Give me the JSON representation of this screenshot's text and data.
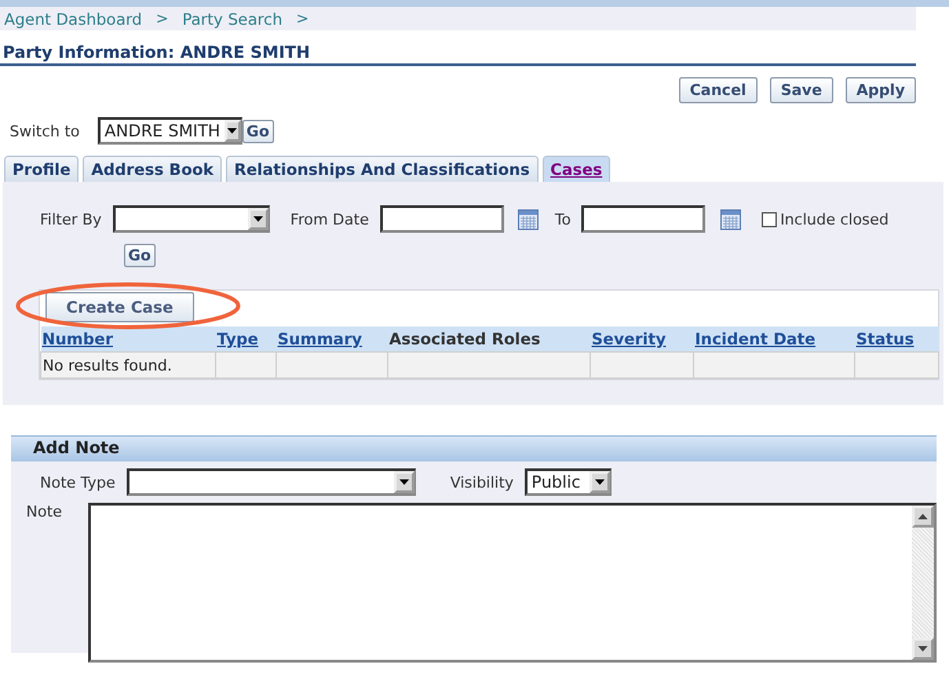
{
  "breadcrumbs": [
    {
      "label": "Agent Dashboard",
      "separator": ">"
    },
    {
      "label": "Party Search",
      "separator": ">"
    }
  ],
  "title": "Party Information: ANDRE SMITH",
  "actions": [
    {
      "label": "Cancel"
    },
    {
      "label": "Save"
    },
    {
      "label": "Apply"
    }
  ],
  "switch_to": {
    "label": "Switch to",
    "value": "ANDRE SMITH",
    "button": "Go"
  },
  "tabs": [
    {
      "label": "Profile",
      "selected": false
    },
    {
      "label": "Address Book",
      "selected": false
    },
    {
      "label": "Relationships And Classifications",
      "selected": false
    },
    {
      "label": "Cases",
      "selected": true
    }
  ],
  "filter": {
    "filter_by_label": "Filter By",
    "from_date_label": "From Date",
    "to_label": "To",
    "include_closed": {
      "label": "Include closed",
      "checked": false
    },
    "go": "Go"
  },
  "create_case": "Create Case",
  "table": {
    "columns": [
      {
        "label": "Number",
        "sortable": true
      },
      {
        "label": "Type",
        "sortable": true
      },
      {
        "label": "Summary",
        "sortable": true
      },
      {
        "label": "Associated Roles",
        "sortable": false
      },
      {
        "label": "Severity",
        "sortable": true
      },
      {
        "label": "Incident Date",
        "sortable": true
      },
      {
        "label": "Status",
        "sortable": true
      }
    ],
    "empty_message": "No results found."
  },
  "add_note": {
    "title": "Add Note",
    "note_type_label": "Note Type",
    "visibility_label": "Visibility",
    "visibility": "Public",
    "note_label": "Note"
  }
}
